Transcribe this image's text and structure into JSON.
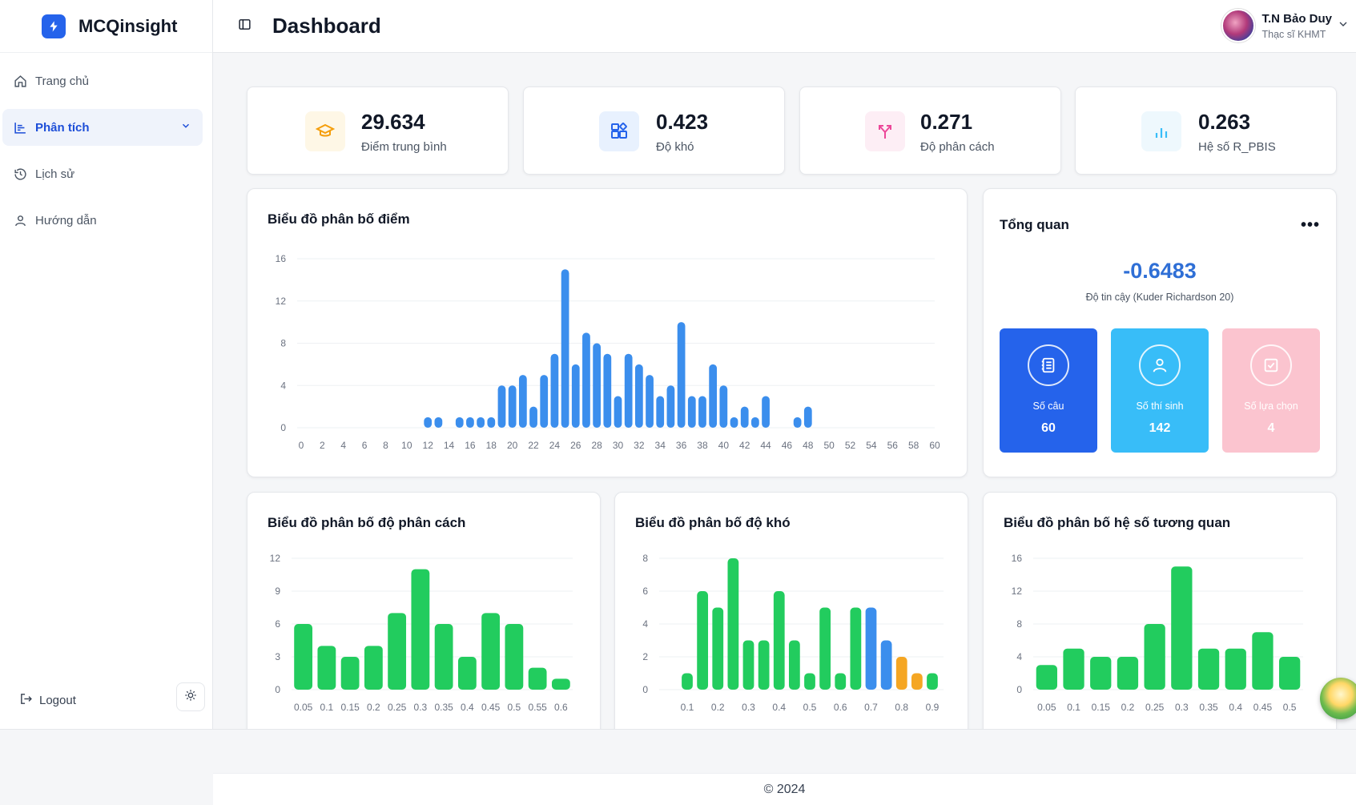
{
  "app": {
    "name": "MCQinsight"
  },
  "header": {
    "title": "Dashboard"
  },
  "user": {
    "name": "T.N Bảo Duy",
    "role": "Thạc sĩ KHMT"
  },
  "sidebar": {
    "items": [
      {
        "label": "Trang chủ",
        "icon": "home-icon"
      },
      {
        "label": "Phân tích",
        "icon": "chart-icon"
      },
      {
        "label": "Lịch sử",
        "icon": "history-icon"
      },
      {
        "label": "Hướng dẫn",
        "icon": "user-icon"
      }
    ],
    "logout": "Logout"
  },
  "stats": [
    {
      "value": "29.634",
      "label": "Điểm trung bình",
      "color": "#f59e0b"
    },
    {
      "value": "0.423",
      "label": "Độ khó",
      "color": "#2563eb"
    },
    {
      "value": "0.271",
      "label": "Độ phân cách",
      "color": "#ec4899"
    },
    {
      "value": "0.263",
      "label": "Hệ số R_PBIS",
      "color": "#38bdf8"
    }
  ],
  "overview": {
    "title": "Tổng quan",
    "kr20_value": "-0.6483",
    "kr20_label": "Độ tin cậy (Kuder Richardson 20)",
    "tiles": [
      {
        "label": "Số câu",
        "value": "60",
        "color": "#2563eb"
      },
      {
        "label": "Số thí sinh",
        "value": "142",
        "color": "#38bdf8"
      },
      {
        "label": "Số lựa chọn",
        "value": "4",
        "color": "#fbc4cf"
      }
    ]
  },
  "footer": {
    "text": "© 2024"
  },
  "chart_data": [
    {
      "type": "bar",
      "title": "Biểu đồ phân bố điểm",
      "x": [
        12,
        13,
        15,
        16,
        17,
        18,
        19,
        20,
        21,
        22,
        23,
        24,
        25,
        26,
        27,
        28,
        29,
        30,
        31,
        32,
        33,
        34,
        35,
        36,
        37,
        38,
        39,
        40,
        41,
        42,
        43,
        44,
        47,
        48
      ],
      "values": [
        1,
        1,
        1,
        1,
        1,
        1,
        4,
        4,
        5,
        2,
        5,
        7,
        15,
        6,
        9,
        8,
        7,
        3,
        7,
        6,
        5,
        3,
        4,
        10,
        3,
        3,
        6,
        4,
        1,
        2,
        1,
        3,
        1,
        2
      ],
      "xticks": [
        "0",
        "2",
        "4",
        "6",
        "8",
        "10",
        "12",
        "14",
        "16",
        "18",
        "20",
        "22",
        "24",
        "26",
        "28",
        "30",
        "32",
        "34",
        "36",
        "38",
        "40",
        "42",
        "44",
        "46",
        "48",
        "50",
        "52",
        "54",
        "56",
        "58",
        "60"
      ],
      "yticks": [
        "0",
        "4",
        "8",
        "12",
        "16"
      ],
      "xlim": [
        0,
        60
      ],
      "ylim": [
        0,
        16
      ],
      "color": "#3b8eed",
      "grid": true
    },
    {
      "type": "bar",
      "title": "Biểu đồ phân bố độ phân cách",
      "categories": [
        "0.05",
        "0.1",
        "0.15",
        "0.2",
        "0.25",
        "0.3",
        "0.35",
        "0.4",
        "0.45",
        "0.5",
        "0.55",
        "0.6"
      ],
      "values": [
        6,
        4,
        3,
        4,
        7,
        11,
        6,
        3,
        7,
        6,
        2,
        1
      ],
      "yticks": [
        "0",
        "3",
        "6",
        "9",
        "12"
      ],
      "ylim": [
        0,
        12
      ],
      "color": "#22cc5e",
      "grid": true
    },
    {
      "type": "bar",
      "title": "Biểu đồ phân bố độ khó",
      "x": [
        0.1,
        0.15,
        0.2,
        0.25,
        0.3,
        0.35,
        0.4,
        0.45,
        0.5,
        0.55,
        0.6,
        0.65,
        0.7,
        0.75,
        0.8,
        0.85,
        0.9
      ],
      "values": [
        1,
        6,
        5,
        8,
        3,
        3,
        6,
        3,
        1,
        5,
        1,
        5,
        5,
        3,
        2,
        1,
        1
      ],
      "colors": [
        "#22cc5e",
        "#22cc5e",
        "#22cc5e",
        "#22cc5e",
        "#22cc5e",
        "#22cc5e",
        "#22cc5e",
        "#22cc5e",
        "#22cc5e",
        "#22cc5e",
        "#22cc5e",
        "#22cc5e",
        "#3b8eed",
        "#3b8eed",
        "#f5a623",
        "#f5a623",
        "#22cc5e"
      ],
      "xticks": [
        "0.1",
        "0.2",
        "0.3",
        "0.4",
        "0.5",
        "0.6",
        "0.7",
        "0.8",
        "0.9"
      ],
      "yticks": [
        "0",
        "2",
        "4",
        "6",
        "8"
      ],
      "ylim": [
        0,
        8
      ],
      "grid": true
    },
    {
      "type": "bar",
      "title": "Biểu đồ phân bố hệ số tương quan",
      "categories": [
        "0.05",
        "0.1",
        "0.15",
        "0.2",
        "0.25",
        "0.3",
        "0.35",
        "0.4",
        "0.45",
        "0.5"
      ],
      "values": [
        3,
        5,
        4,
        4,
        8,
        15,
        5,
        5,
        7,
        4
      ],
      "yticks": [
        "0",
        "4",
        "8",
        "12",
        "16"
      ],
      "ylim": [
        0,
        16
      ],
      "color": "#22cc5e",
      "grid": true
    }
  ]
}
